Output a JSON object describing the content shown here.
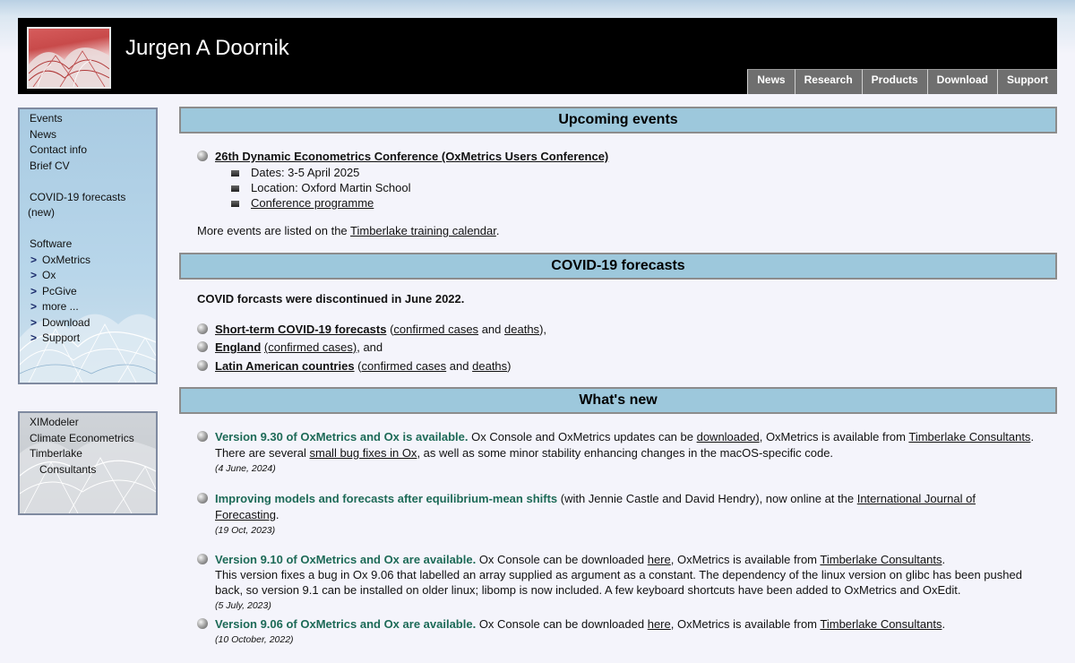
{
  "header": {
    "title": "Jurgen A Doornik",
    "nav": [
      "News",
      "Research",
      "Products",
      "Download",
      "Support"
    ]
  },
  "sidebar": {
    "items": [
      "Events",
      "News",
      "Contact info",
      "Brief CV"
    ],
    "covid_1": "COVID-19 forecasts",
    "covid_2": "(new)",
    "software": "Software",
    "chevron": ">",
    "software_items": [
      "OxMetrics",
      "Ox",
      "PcGive",
      "more ...",
      "Download",
      "Support"
    ],
    "extra": [
      "XIModeler",
      "Climate Econometrics",
      "Timberlake",
      "Consultants"
    ]
  },
  "events": {
    "heading": "Upcoming events",
    "title": "26th Dynamic Econometrics Conference (OxMetrics Users Conference)",
    "dates": "Dates: 3-5 April 2025",
    "location": "Location: Oxford Martin School",
    "programme": "Conference programme",
    "more_prefix": "More events are listed on the ",
    "more_link": "Timberlake training calendar",
    "more_suffix": "."
  },
  "covid": {
    "heading": "COVID-19 forecasts",
    "notice": "COVID forcasts were discontinued in June 2022.",
    "short_term": "Short-term COVID-19 forecasts",
    "confirmed": "confirmed cases",
    "and": "and",
    "deaths": "deaths",
    "england": "England",
    "england_paren": "(confirmed cases)",
    "england_tail": ", and",
    "latin": "Latin American countries"
  },
  "whatsnew": {
    "heading": "What's new",
    "item1": {
      "title": "Version 9.30 of OxMetrics and Ox is available.",
      "t1": " Ox Console and OxMetrics updates can be ",
      "l1": "downloaded",
      "t2": ", OxMetrics is available from ",
      "l2": "Timberlake Consultants",
      "t3": ".",
      "line2a": "There are several ",
      "line2link": "small bug fixes in Ox",
      "line2b": ", as well as some minor stability enhancing changes in the macOS-specific code.",
      "date": "(4 June, 2024)"
    },
    "item2": {
      "title": "Improving models and forecasts after equilibrium-mean shifts",
      "t1": " (with Jennie Castle and David Hendry), now online at the ",
      "l1a": "International Journal of",
      "l1b": "Forecasting",
      "t2": ".",
      "date": "(19 Oct, 2023)"
    },
    "item3": {
      "title": "Version 9.10 of OxMetrics and Ox are available.",
      "t1": " Ox Console can be downloaded ",
      "l1": "here",
      "t2": ", OxMetrics is available from ",
      "l2": "Timberlake Consultants",
      "t3": ".",
      "line2": "This version fixes a bug in Ox 9.06 that labelled an array supplied as argument as a constant. The dependency of the linux version on glibc has been pushed",
      "line3": "back, so version 9.1 can be installed on older linux; libomp is now included. A few keyboard shortcuts have been added to OxMetrics and OxEdit.",
      "date": "(5 July, 2023)"
    },
    "item4": {
      "title": "Version 9.06 of OxMetrics and Ox are available.",
      "t1": " Ox Console can be downloaded ",
      "l1": "here",
      "t2": ", OxMetrics is available from ",
      "l2": "Timberlake Consultants",
      "t3": ".",
      "date": "(10 October, 2022)"
    }
  },
  "colors": {
    "header_bg": "#000000",
    "section_header": "#9dc8dc",
    "news_title": "#1d6a57",
    "nav_button": "#6f6f6f"
  }
}
